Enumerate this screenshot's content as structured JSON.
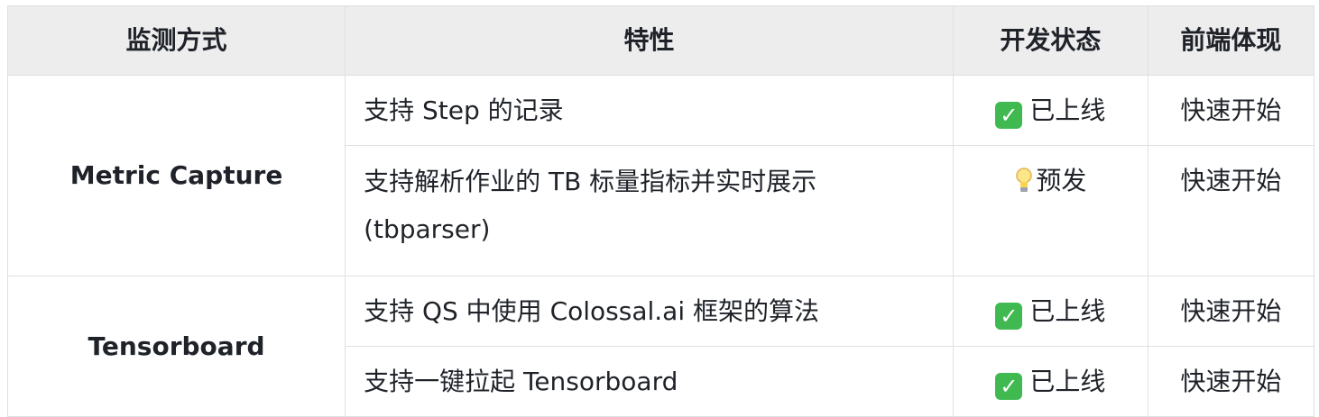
{
  "headers": [
    "监测方式",
    "特性",
    "开发状态",
    "前端体现"
  ],
  "rows": [
    {
      "method": "Metric Capture",
      "feature": "支持 Step 的记录",
      "status_icon": "check-icon",
      "status": "已上线",
      "frontend": "快速开始"
    },
    {
      "feature": "支持解析作业的 TB 标量指标并实时展示 (tbparser)",
      "status_icon": "lightbulb-icon",
      "status": "预发",
      "frontend": "快速开始"
    },
    {
      "method": "Tensorboard",
      "feature": "支持 QS 中使用 Colossal.ai 框架的算法",
      "status_icon": "check-icon",
      "status": "已上线",
      "frontend": "快速开始"
    },
    {
      "feature": "支持一键拉起 Tensorboard",
      "status_icon": "check-icon",
      "status": "已上线",
      "frontend": "快速开始"
    }
  ],
  "colors": {
    "header_bg": "#ededed",
    "border": "#dee0e3",
    "check_bg": "#3fb950"
  }
}
